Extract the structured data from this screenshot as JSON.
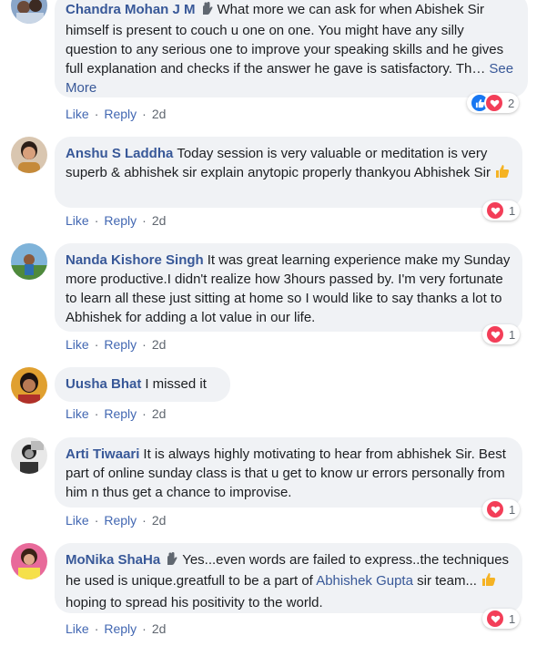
{
  "colors": {
    "name": "#385898",
    "link": "#4267b2",
    "bubble": "#f0f2f5",
    "meta": "#606770",
    "like": "#1877f2",
    "love": "#f33e58"
  },
  "comments": [
    {
      "author": "Chandra Mohan J M",
      "text": "What more we can ask for when Abishek Sir himself is present to couch u one on one. You might have any silly question to any serious one to improve your speaking skills and he gives full explanation and checks if the answer he gave is satisfactory. Th…",
      "see_more": "See More",
      "like": "Like",
      "reply": "Reply",
      "time": "2d",
      "reaction_count": "2"
    },
    {
      "author": "Anshu S Laddha",
      "text": "Today session is very valuable or meditation is very superb & abhishek sir explain anytopic properly thankyou Abhishek Sir",
      "like": "Like",
      "reply": "Reply",
      "time": "2d",
      "reaction_count": "1"
    },
    {
      "author": "Nanda Kishore Singh",
      "text": "It was great learning experience make my Sunday more productive.I didn't realize how 3hours passed by. I'm very fortunate to learn all these just sitting at home so I would like to say thanks a lot to Abhishek for adding a lot value in our life.",
      "like": "Like",
      "reply": "Reply",
      "time": "2d",
      "reaction_count": "1"
    },
    {
      "author": "Uusha Bhat",
      "text": "I missed it",
      "like": "Like",
      "reply": "Reply",
      "time": "2d"
    },
    {
      "author": "Arti Tiwaari",
      "text": "It is always highly motivating to hear from abhishek Sir. Best part of online sunday class is that u get to know ur errors personally from him n thus get a chance to improvise.",
      "like": "Like",
      "reply": "Reply",
      "time": "2d",
      "reaction_count": "1"
    },
    {
      "author": "MoNika ShaHa",
      "text_before": "Yes...even words are failed to express..the techniques he used is unique.greatfull to be a part of",
      "mention": "Abhishek Gupta",
      "text_after": "sir team...",
      "text_end": "hoping to spread his positivity to the world.",
      "like": "Like",
      "reply": "Reply",
      "time": "2d",
      "reaction_count": "1"
    }
  ]
}
